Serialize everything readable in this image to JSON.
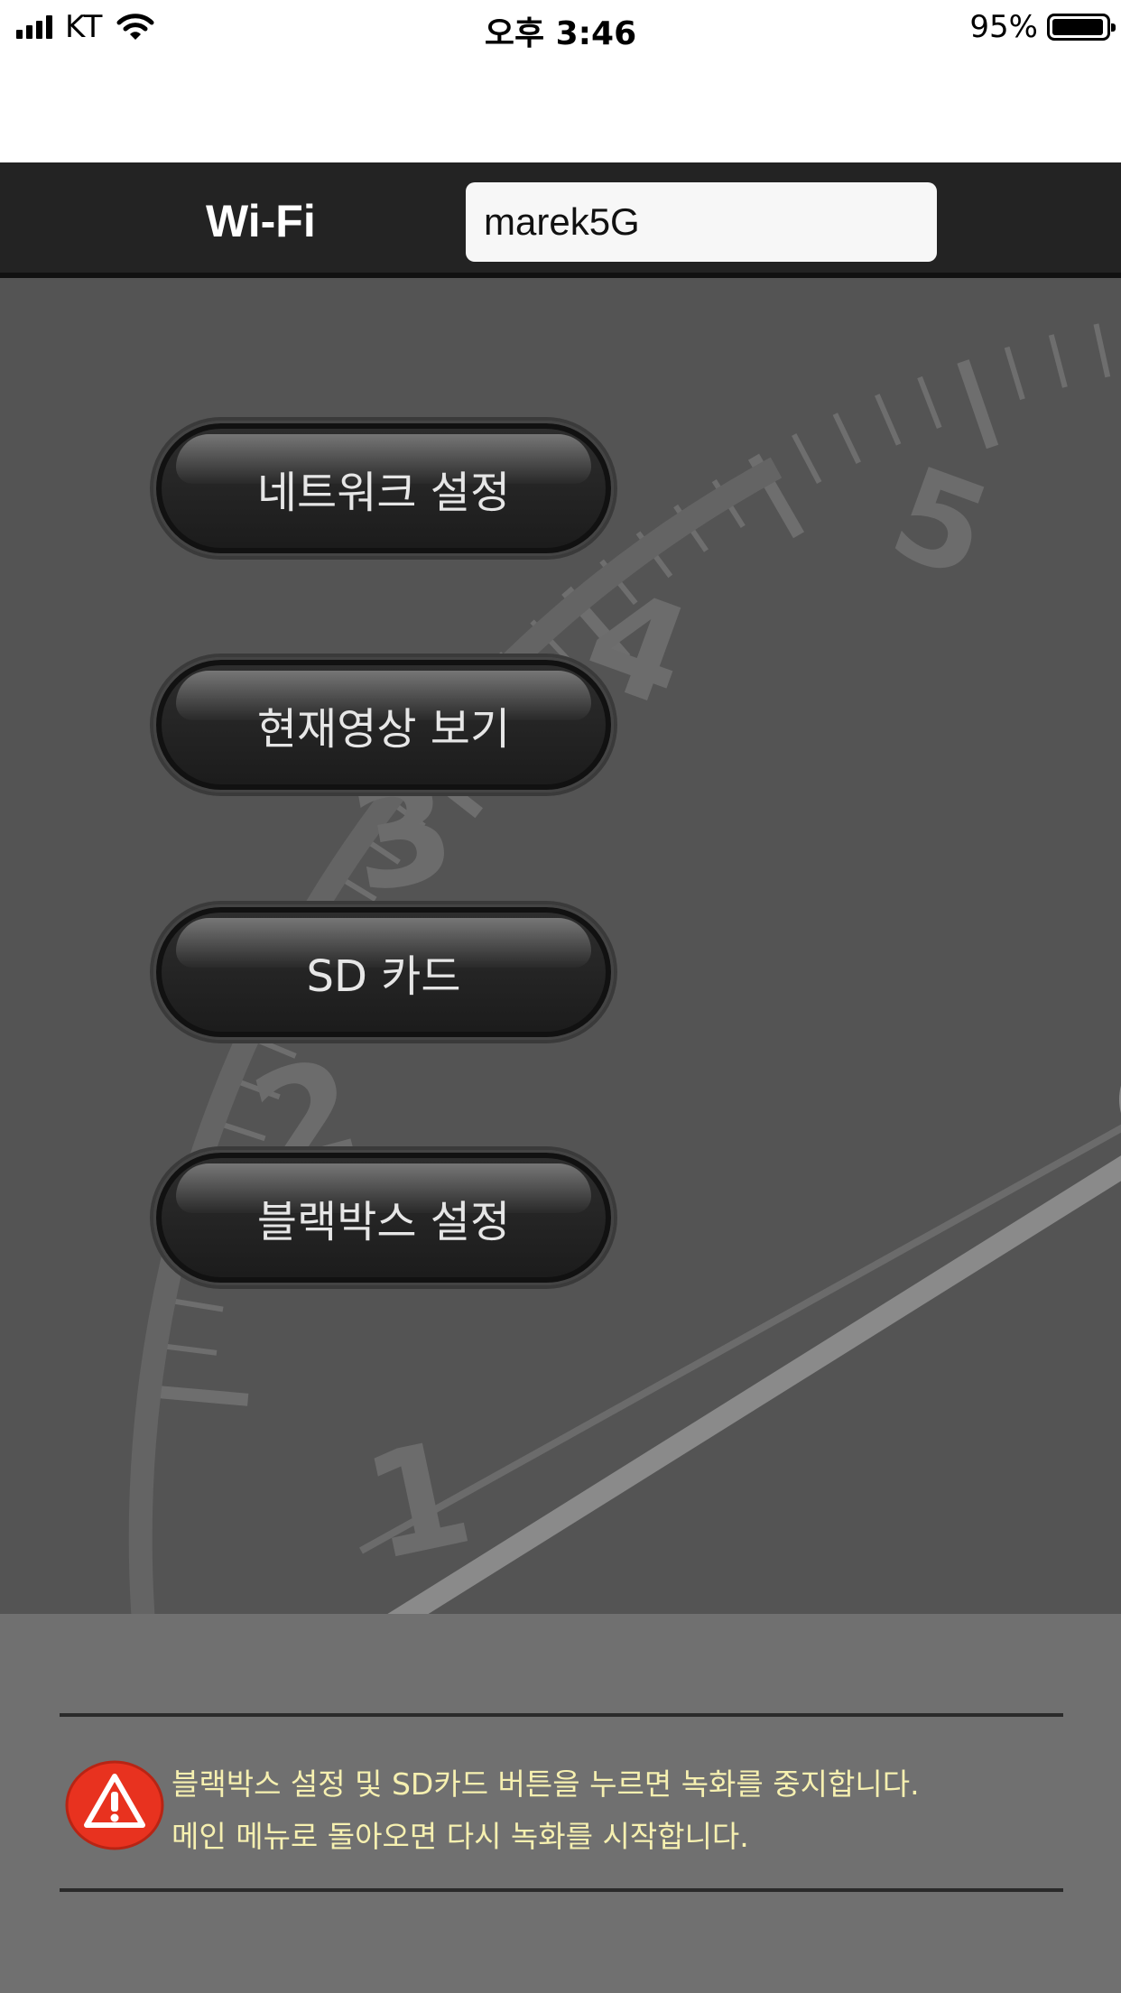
{
  "status_bar": {
    "carrier": "KT",
    "time": "오후 3:46",
    "battery": "95%",
    "battery_level": 0.95
  },
  "header": {
    "label": "Wi-Fi",
    "ssid_value": "marek5G"
  },
  "menu": {
    "items": [
      {
        "label": "네트워크 설정"
      },
      {
        "label": "현재영상 보기"
      },
      {
        "label": "SD 카드"
      },
      {
        "label": "블랙박스 설정"
      }
    ]
  },
  "background": {
    "gauge_numerals": [
      "1",
      "2",
      "3",
      "4",
      "5"
    ]
  },
  "footer": {
    "notice_line1": "블랙박스 설정 및 SD카드 버튼을 누르면 녹화를 중지합니다.",
    "notice_line2": "메인 메뉴로 돌아오면 다시 녹화를 시작합니다."
  },
  "colors": {
    "header_bg": "#232323",
    "main_bg": "#545454",
    "footer_bg": "#707070",
    "notice_text": "#f6f0b0",
    "warning_red": "#e8321f"
  },
  "icons": [
    "signal-icon",
    "wifi-icon",
    "battery-icon",
    "warning-icon"
  ]
}
